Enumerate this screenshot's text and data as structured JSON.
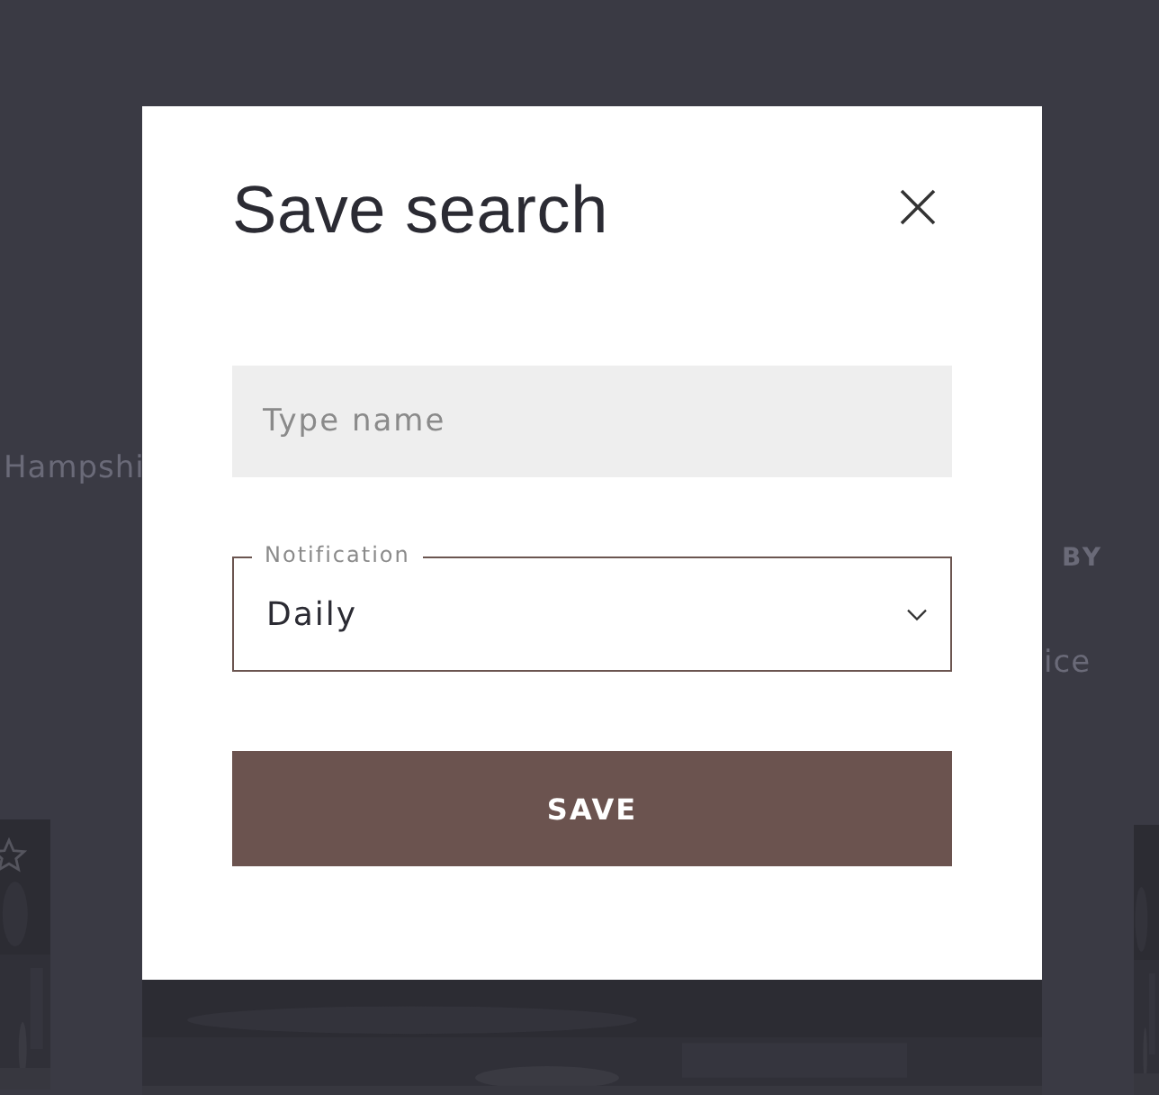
{
  "background": {
    "left_text": "Hampshi",
    "right_heading": "BY",
    "right_text": "ice"
  },
  "dialog": {
    "title": "Save search",
    "name_field": {
      "placeholder": "Type name"
    },
    "notification": {
      "label": "Notification",
      "value": "Daily"
    },
    "save_button": "SAVE"
  }
}
